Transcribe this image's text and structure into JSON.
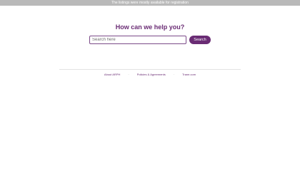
{
  "banner": {
    "text": "The listings were mostly available for registration"
  },
  "help": {
    "title": "How can we help you?"
  },
  "search": {
    "placeholder": "Search here",
    "value": "",
    "button_label": "Search"
  },
  "footer": {
    "links": [
      {
        "label": "About ARPH"
      },
      {
        "label": "Policies & Agreements"
      },
      {
        "label": "Trane.com"
      }
    ],
    "separator": "·"
  },
  "colors": {
    "accent": "#6a2c74",
    "banner_bg": "#b9b9b9"
  }
}
